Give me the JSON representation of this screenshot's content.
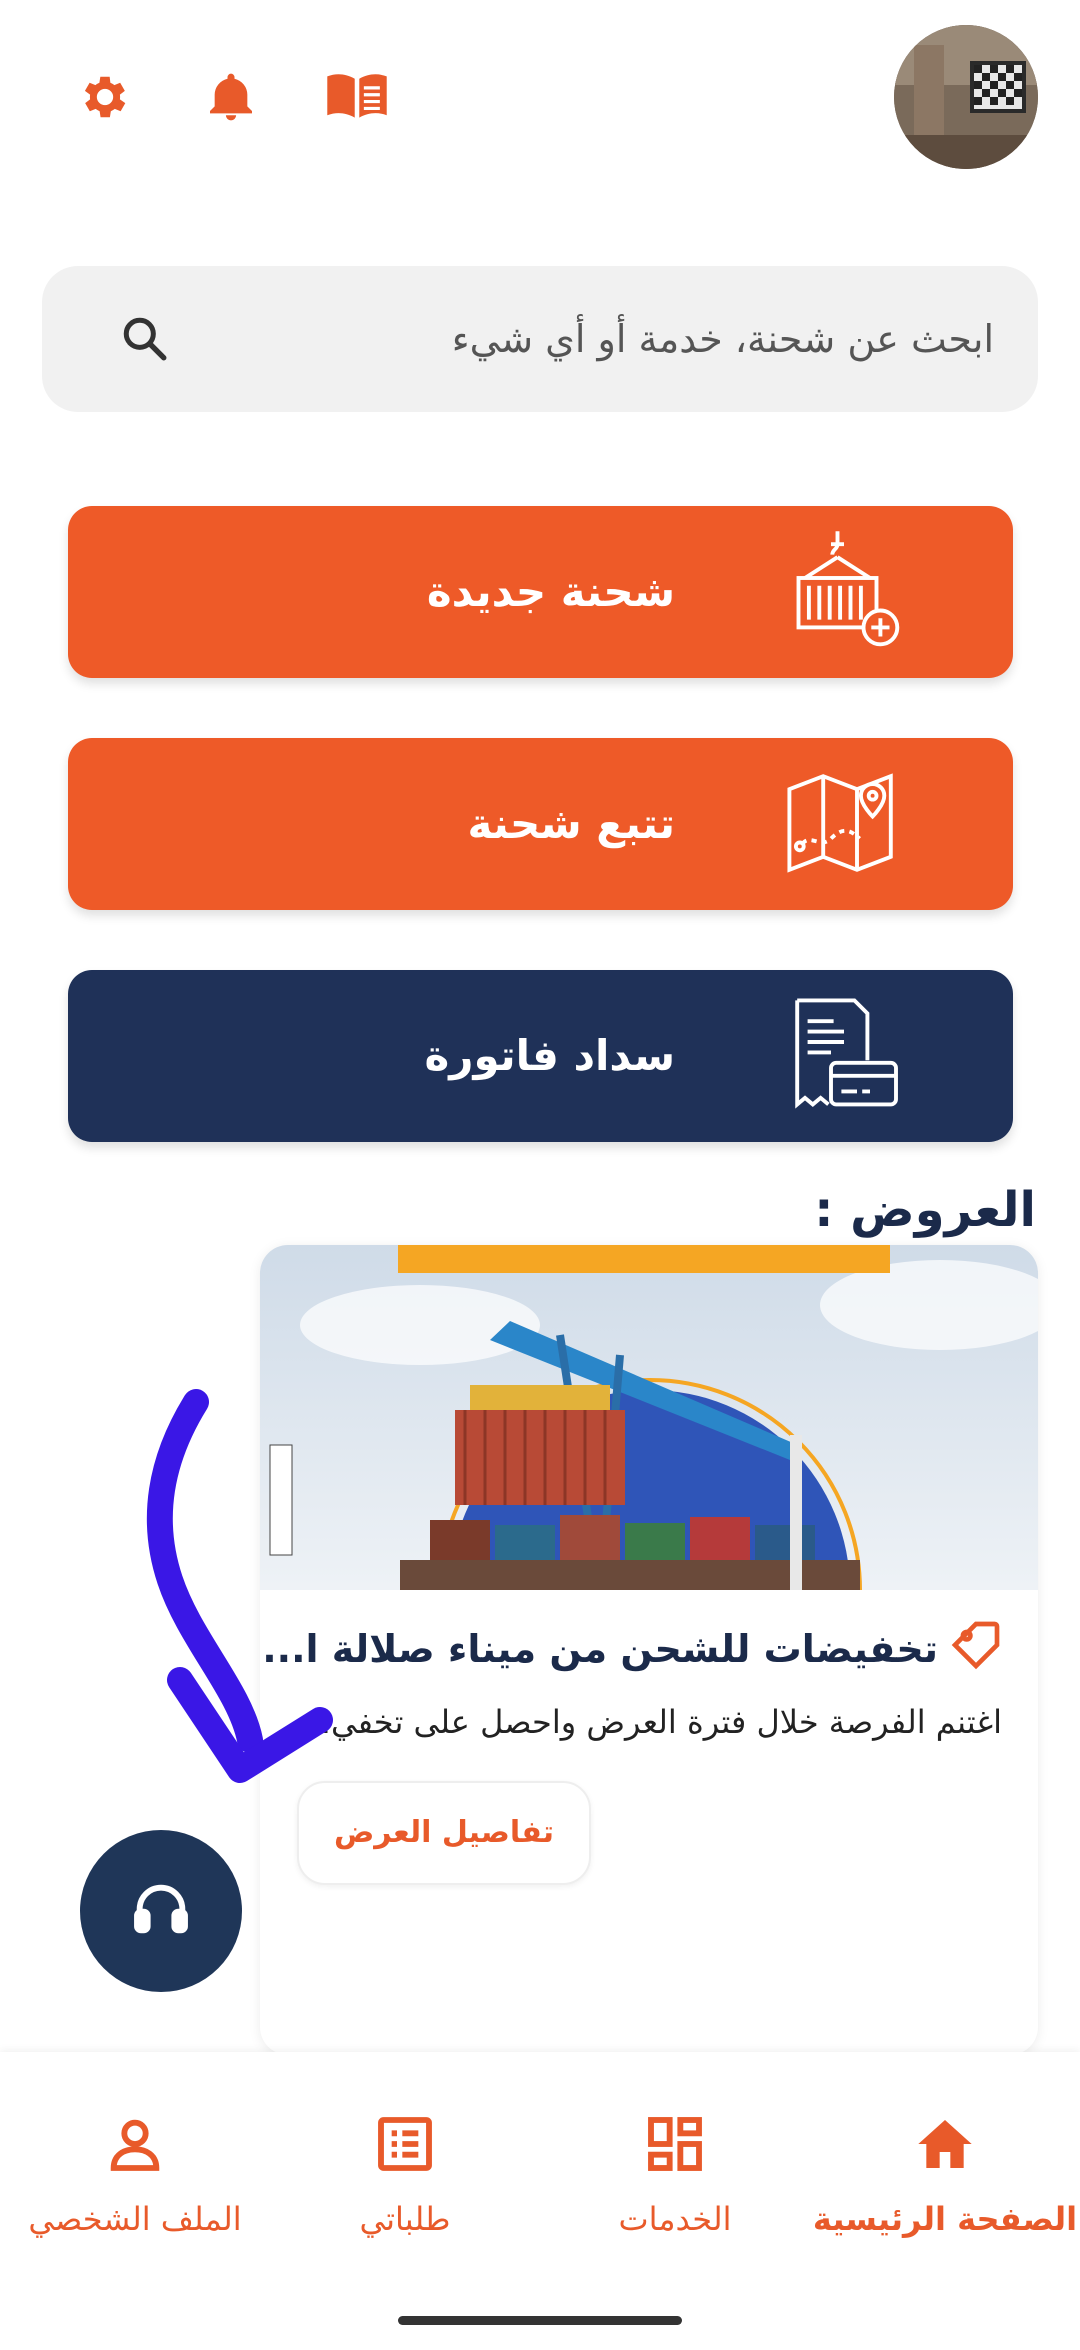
{
  "colors": {
    "accent": "#e85a2a",
    "navy": "#1f3658",
    "title": "#1b2a4a"
  },
  "header": {
    "icons": [
      "gear-icon",
      "bell-icon",
      "book-icon"
    ]
  },
  "search": {
    "placeholder": "ابحث عن شحنة، خدمة أو أي شيء"
  },
  "actions": [
    {
      "label": "شحنة جديدة",
      "icon": "container-crane-icon",
      "color": "#ee5a28"
    },
    {
      "label": "تتبع شحنة",
      "icon": "map-pin-icon",
      "color": "#ee5a28"
    },
    {
      "label": "سداد فاتورة",
      "icon": "invoice-card-icon",
      "color": "#1f3158"
    }
  ],
  "offers": {
    "title": "العروض :",
    "card": {
      "title": "تخفيضات للشحن من ميناء صلالة ا...",
      "description": "اغتنم الفرصة خلال فترة العرض واحصل على تخفي...",
      "button": "تفاصيل العرض"
    }
  },
  "bottom_nav": [
    {
      "label": "الملف الشخصي",
      "icon": "person-icon"
    },
    {
      "label": "طلباتي",
      "icon": "list-icon"
    },
    {
      "label": "الخدمات",
      "icon": "grid-icon"
    },
    {
      "label": "الصفحة الرئيسية",
      "icon": "home-icon",
      "active": true
    }
  ]
}
